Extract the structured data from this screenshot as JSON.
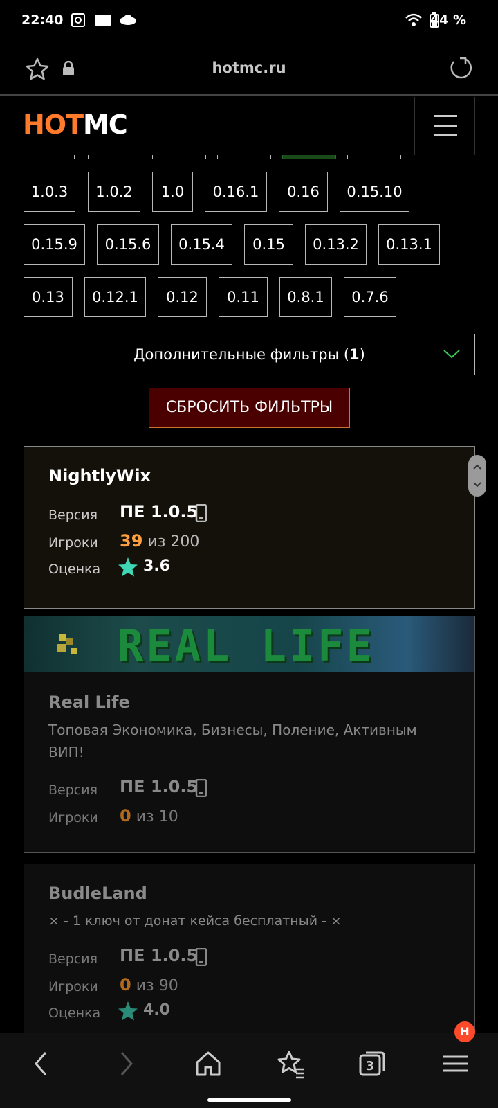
{
  "status": {
    "time": "22:40",
    "battery": "44 %"
  },
  "browser": {
    "url": "hotmc.ru",
    "tab_count": "3",
    "menu_badge": "H"
  },
  "site": {
    "logo_hot": "HOT",
    "logo_mc": "MC"
  },
  "versions": {
    "row1": [
      "1.0.3",
      "1.0.2",
      "1.0",
      "0.16.1",
      "0.16",
      "0.15.10"
    ],
    "row2": [
      "0.15.9",
      "0.15.6",
      "0.15.4",
      "0.15",
      "0.13.2",
      "0.13.1"
    ],
    "row3": [
      "0.13",
      "0.12.1",
      "0.12",
      "0.11",
      "0.8.1",
      "0.7.6"
    ]
  },
  "filters": {
    "extra_label": "Дополнительные фильтры (",
    "extra_count": "1",
    "extra_close": ")",
    "reset_label": "СБРОСИТЬ ФИЛЬТРЫ"
  },
  "labels": {
    "version": "Версия",
    "players": "Игроки",
    "rating": "Оценка",
    "of": "из"
  },
  "servers": [
    {
      "name": "NightlyWix",
      "version": "ПЕ 1.0.5",
      "players_current": "39",
      "players_max": "200",
      "rating": "3.6"
    },
    {
      "name": "Real Life",
      "banner_text": "REAL LIFE",
      "description": "Топовая Экономика, Бизнесы, Поление, Активным ВИП!",
      "version": "ПЕ 1.0.5",
      "players_current": "0",
      "players_max": "10"
    },
    {
      "name": "BudleLand",
      "description": "× - 1 ключ от донат кейса бесплатный - ×",
      "version": "ПЕ 1.0.5",
      "players_current": "0",
      "players_max": "90",
      "rating": "4.0"
    }
  ],
  "colors": {
    "accent": "#ff7a2a",
    "star": "#3ed6b4",
    "reset_bg": "#4a0000"
  }
}
